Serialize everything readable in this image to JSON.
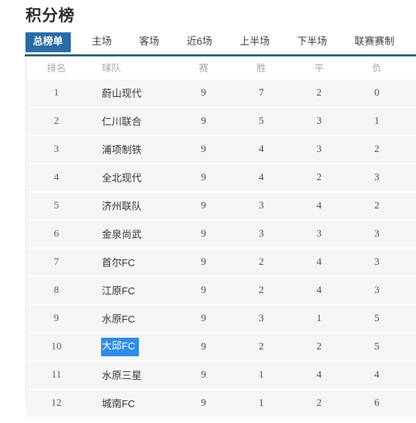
{
  "page": {
    "title": "积分榜",
    "accent_active_tab_bg": "#2b6ba4",
    "accent_underline": "#235c6d",
    "selection_highlight": "#2f8ce6",
    "row_bg": "#f5f5f5"
  },
  "tabs": [
    {
      "label": "总榜单",
      "active": true
    },
    {
      "label": "主场",
      "active": false
    },
    {
      "label": "客场",
      "active": false
    },
    {
      "label": "近6场",
      "active": false
    },
    {
      "label": "上半场",
      "active": false
    },
    {
      "label": "下半场",
      "active": false
    },
    {
      "label": "联赛赛制",
      "active": false
    }
  ],
  "table": {
    "columns": [
      "排名",
      "球队",
      "赛",
      "胜",
      "平",
      "负"
    ],
    "rows": [
      {
        "rank": "1",
        "team": "蔚山现代",
        "played": "9",
        "win": "7",
        "draw": "2",
        "loss": "0",
        "selected": false
      },
      {
        "rank": "2",
        "team": "仁川联合",
        "played": "9",
        "win": "5",
        "draw": "3",
        "loss": "1",
        "selected": false
      },
      {
        "rank": "3",
        "team": "浦项制铁",
        "played": "9",
        "win": "4",
        "draw": "3",
        "loss": "2",
        "selected": false
      },
      {
        "rank": "4",
        "team": "全北现代",
        "played": "9",
        "win": "4",
        "draw": "2",
        "loss": "3",
        "selected": false
      },
      {
        "rank": "5",
        "team": "济州联队",
        "played": "9",
        "win": "3",
        "draw": "4",
        "loss": "2",
        "selected": false
      },
      {
        "rank": "6",
        "team": "金泉尚武",
        "played": "9",
        "win": "3",
        "draw": "3",
        "loss": "3",
        "selected": false
      },
      {
        "rank": "7",
        "team": "首尔FC",
        "played": "9",
        "win": "2",
        "draw": "4",
        "loss": "3",
        "selected": false
      },
      {
        "rank": "8",
        "team": "江原FC",
        "played": "9",
        "win": "2",
        "draw": "4",
        "loss": "3",
        "selected": false
      },
      {
        "rank": "9",
        "team": "水原FC",
        "played": "9",
        "win": "3",
        "draw": "1",
        "loss": "5",
        "selected": false
      },
      {
        "rank": "10",
        "team": "大邱FC",
        "played": "9",
        "win": "2",
        "draw": "2",
        "loss": "5",
        "selected": true
      },
      {
        "rank": "11",
        "team": "水原三星",
        "played": "9",
        "win": "1",
        "draw": "4",
        "loss": "4",
        "selected": false
      },
      {
        "rank": "12",
        "team": "城南FC",
        "played": "9",
        "win": "1",
        "draw": "2",
        "loss": "6",
        "selected": false
      }
    ]
  }
}
